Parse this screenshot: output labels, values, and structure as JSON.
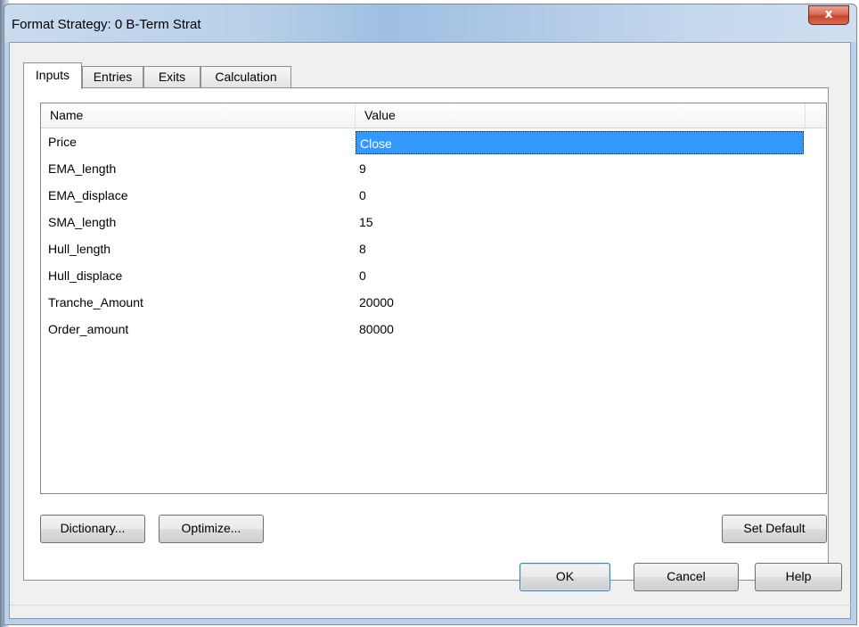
{
  "window": {
    "title": "Format Strategy: 0 B-Term Strat",
    "close_label": "x"
  },
  "tabs": [
    {
      "label": "Inputs",
      "active": true
    },
    {
      "label": "Entries",
      "active": false
    },
    {
      "label": "Exits",
      "active": false
    },
    {
      "label": "Calculation",
      "active": false
    }
  ],
  "grid": {
    "columns": [
      "Name",
      "Value"
    ],
    "rows": [
      {
        "name": "Price",
        "value": "Close",
        "selected": true
      },
      {
        "name": "EMA_length",
        "value": "9"
      },
      {
        "name": "EMA_displace",
        "value": "0"
      },
      {
        "name": "SMA_length",
        "value": "15"
      },
      {
        "name": "Hull_length",
        "value": "8"
      },
      {
        "name": "Hull_displace",
        "value": "0"
      },
      {
        "name": "Tranche_Amount",
        "value": "20000"
      },
      {
        "name": "Order_amount",
        "value": "80000"
      }
    ]
  },
  "panel_buttons": {
    "dictionary": "Dictionary...",
    "optimize": "Optimize...",
    "set_default": "Set Default"
  },
  "dialog_buttons": {
    "ok": "OK",
    "cancel": "Cancel",
    "help": "Help"
  },
  "colors": {
    "selection": "#3399ff",
    "close_button": "#c7462c"
  }
}
